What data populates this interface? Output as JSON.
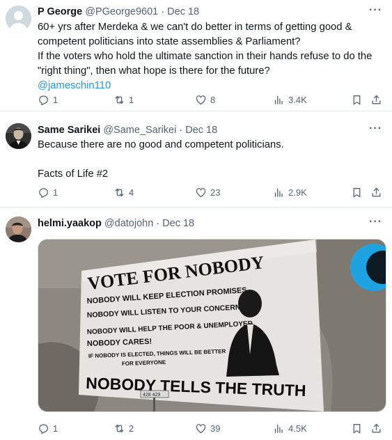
{
  "tweets": [
    {
      "name": "P George",
      "handle": "@PGeorge9601",
      "sep": "·",
      "date": "Dec 18",
      "lines": [
        "60+ yrs after Merdeka & we can't do better in terms of getting good &",
        "competent politicians into state assemblies & Parliament?",
        "If the voters who hold the ultimate sanction in their hands refuse to do the",
        "\"right thing\", then what hope is there for the future?"
      ],
      "mention": "@jameschin110",
      "stats": {
        "replies": "1",
        "retweets": "1",
        "likes": "8",
        "views": "3.4K"
      }
    },
    {
      "name": "Same Sarikei",
      "handle": "@Same_Sarikei",
      "sep": "·",
      "date": "Dec 18",
      "lines": [
        "Because there are no good and competent politicians.",
        "",
        "Facts of Life #2"
      ],
      "stats": {
        "replies": "1",
        "retweets": "4",
        "likes": "23",
        "views": "2.9K"
      }
    },
    {
      "name": "helmi.yaakop",
      "handle": "@datojohn",
      "sep": "·",
      "date": "Dec 18",
      "media": {
        "headline": "VOTE FOR NOBODY",
        "rows": [
          "NOBODY WILL KEEP ELECTION PROMISES",
          "NOBODY WILL LISTEN TO YOUR CONCERNS",
          "NOBODY WILL HELP THE POOR & UNEMPLOYED",
          "NOBODY CARES!",
          "IF NOBODY IS ELECTED, THINGS WILL BE BETTER",
          "FOR EVERYONE"
        ],
        "footer": "NOBODY TELLS THE TRUTH",
        "sign": "428  429"
      },
      "stats": {
        "replies": "1",
        "retweets": "2",
        "likes": "39",
        "views": "4.5K"
      }
    }
  ],
  "more_label": "···",
  "colors": {
    "text": "#0f1419",
    "muted": "#536471",
    "link": "#1d9bf0",
    "divider": "#e1e8ed"
  },
  "icons": [
    "reply-icon",
    "retweet-icon",
    "like-icon",
    "views-icon",
    "bookmark-icon",
    "share-icon",
    "more-icon"
  ]
}
